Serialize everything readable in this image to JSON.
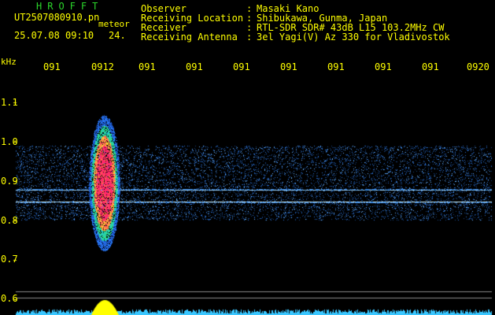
{
  "header": {
    "title": "HROFFT",
    "filename": "UT2507080910.pn",
    "meteor_label": "meteor",
    "datetime": "25.07.08 09:10",
    "count": "24."
  },
  "info": [
    {
      "label": "Observer",
      "value": "Masaki Kano"
    },
    {
      "label": "Receiving Location",
      "value": "Shibukawa, Gunma, Japan"
    },
    {
      "label": "Receiver",
      "value": "RTL-SDR SDR# 43dB L15 103.2MHz CW"
    },
    {
      "label": "Receiving Antenna",
      "value": "3el Yagi(V) Az 330 for Vladivostok"
    }
  ],
  "axis": {
    "y_unit": "kHz",
    "x_ticks": [
      "091",
      "0912",
      "091",
      "091",
      "091",
      "091",
      "091",
      "091",
      "091",
      "0920"
    ],
    "y_ticks": [
      "1.1",
      "1.0",
      "0.9",
      "0.8",
      "0.7",
      "0.6"
    ]
  },
  "colors": {
    "text": "#ffff00",
    "title": "#2bd62b",
    "background": "#000000",
    "noise_band": "#3fa0ff",
    "echo_core": "#ff2a6a",
    "baseline": "#00e5ff",
    "peak": "#ffff00"
  }
}
